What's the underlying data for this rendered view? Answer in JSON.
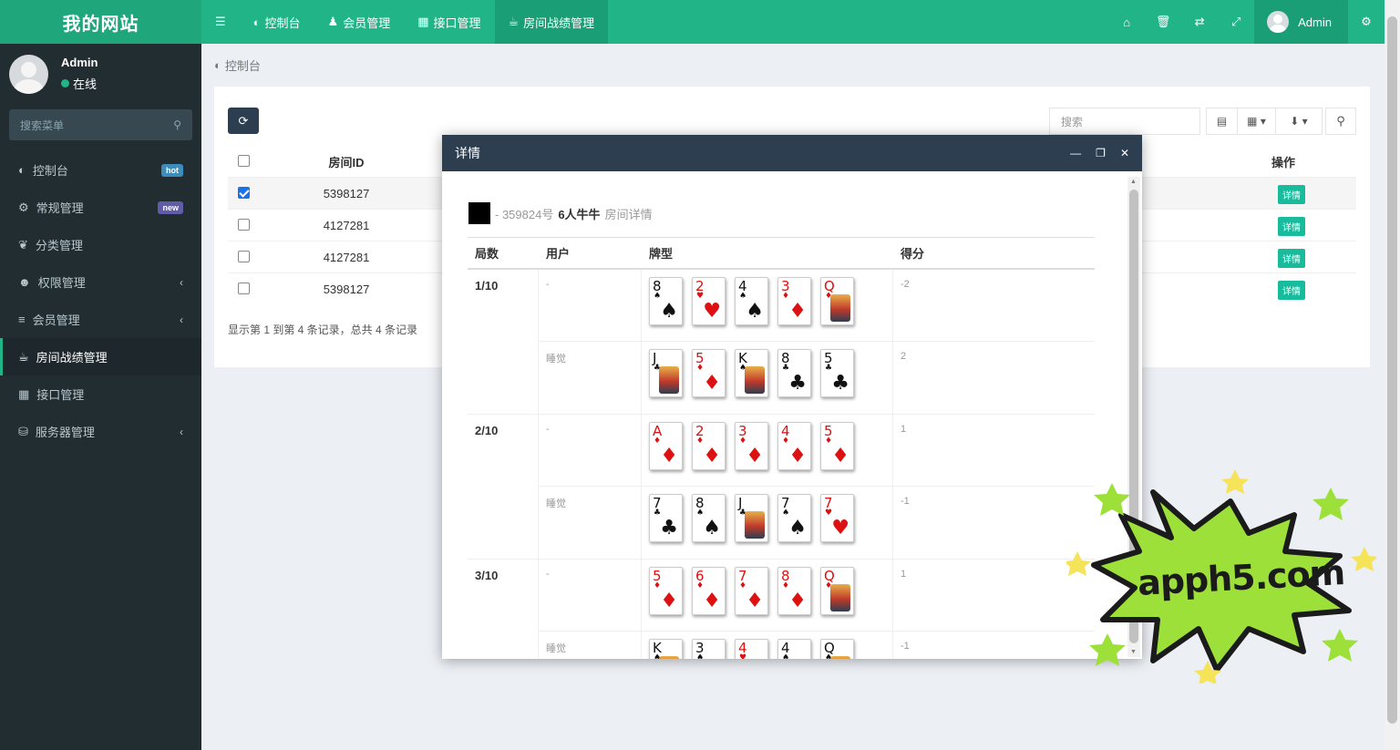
{
  "app": {
    "logo": "我的网站"
  },
  "topnav": {
    "items": [
      {
        "icon": "dashboard-icon",
        "label": "控制台"
      },
      {
        "icon": "user-icon",
        "label": "会员管理"
      },
      {
        "icon": "calendar-icon",
        "label": "接口管理"
      },
      {
        "icon": "coffee-icon",
        "label": "房间战绩管理"
      }
    ],
    "active_index": 3,
    "right_icons": [
      "home-icon",
      "trash-icon",
      "language-icon",
      "fullscreen-icon"
    ],
    "user": "Admin",
    "settings_icon": "cogs-icon"
  },
  "sidebar": {
    "user": {
      "name": "Admin",
      "status": "在线",
      "status_color": "#20b487"
    },
    "search": {
      "placeholder": "搜索菜单"
    },
    "items": [
      {
        "icon": "dashboard-icon",
        "label": "控制台",
        "badge": "hot",
        "badge_color": "#3c8dbc"
      },
      {
        "icon": "cogs-icon",
        "label": "常规管理",
        "badge": "new",
        "badge_color": "#605ca8"
      },
      {
        "icon": "leaf-icon",
        "label": "分类管理"
      },
      {
        "icon": "group-icon",
        "label": "权限管理",
        "chevron": "‹"
      },
      {
        "icon": "list-icon",
        "label": "会员管理",
        "chevron": "‹"
      },
      {
        "icon": "coffee-icon",
        "label": "房间战绩管理",
        "active": true
      },
      {
        "icon": "calendar-icon",
        "label": "接口管理"
      },
      {
        "icon": "database-icon",
        "label": "服务器管理",
        "chevron": "‹"
      }
    ]
  },
  "breadcrumb": {
    "label": "控制台"
  },
  "toolbar": {
    "search_placeholder": "搜索"
  },
  "table": {
    "headers": {
      "id": "房间ID",
      "op": "操作"
    },
    "rows": [
      {
        "id": "5398127",
        "checked": true,
        "action": "详情"
      },
      {
        "id": "4127281",
        "checked": false,
        "action": "详情"
      },
      {
        "id": "4127281",
        "checked": false,
        "action": "详情"
      },
      {
        "id": "5398127",
        "checked": false,
        "action": "详情"
      }
    ],
    "pagination": "显示第 1 到第 4 条记录，总共 4 条记录"
  },
  "modal": {
    "title": "详情",
    "controls": [
      "minimize-icon",
      "maximize-icon",
      "close-icon"
    ],
    "room_number": "- 359824号",
    "room_game": "6人牛牛",
    "room_suffix": "房间详情",
    "headers": {
      "round": "局数",
      "user": "用户",
      "cards": "牌型",
      "score": "得分"
    },
    "rounds": [
      {
        "round": "1/10",
        "rows": [
          {
            "user": "-",
            "score": "-2",
            "cards": [
              {
                "rank": "8",
                "suit": "♠"
              },
              {
                "rank": "2",
                "suit": "♥"
              },
              {
                "rank": "4",
                "suit": "♠"
              },
              {
                "rank": "3",
                "suit": "♦"
              },
              {
                "rank": "Q",
                "suit": "♦",
                "face": true
              }
            ]
          },
          {
            "user": "睡觉",
            "score": "2",
            "cards": [
              {
                "rank": "J",
                "suit": "♣",
                "face": true
              },
              {
                "rank": "5",
                "suit": "♦"
              },
              {
                "rank": "K",
                "suit": "♠",
                "face": true
              },
              {
                "rank": "8",
                "suit": "♣"
              },
              {
                "rank": "5",
                "suit": "♣"
              }
            ]
          }
        ]
      },
      {
        "round": "2/10",
        "rows": [
          {
            "user": "-",
            "score": "1",
            "cards": [
              {
                "rank": "A",
                "suit": "♦"
              },
              {
                "rank": "2",
                "suit": "♦"
              },
              {
                "rank": "3",
                "suit": "♦"
              },
              {
                "rank": "4",
                "suit": "♦"
              },
              {
                "rank": "5",
                "suit": "♦"
              }
            ]
          },
          {
            "user": "睡觉",
            "score": "-1",
            "cards": [
              {
                "rank": "7",
                "suit": "♣"
              },
              {
                "rank": "8",
                "suit": "♠"
              },
              {
                "rank": "J",
                "suit": "♣",
                "face": true
              },
              {
                "rank": "7",
                "suit": "♠"
              },
              {
                "rank": "7",
                "suit": "♥"
              }
            ]
          }
        ]
      },
      {
        "round": "3/10",
        "rows": [
          {
            "user": "-",
            "score": "1",
            "cards": [
              {
                "rank": "5",
                "suit": "♦"
              },
              {
                "rank": "6",
                "suit": "♦"
              },
              {
                "rank": "7",
                "suit": "♦"
              },
              {
                "rank": "8",
                "suit": "♦"
              },
              {
                "rank": "Q",
                "suit": "♦",
                "face": true
              }
            ]
          },
          {
            "user": "睡觉",
            "score": "-1",
            "cards": [
              {
                "rank": "K",
                "suit": "♠",
                "face": true
              },
              {
                "rank": "3",
                "suit": "♠"
              },
              {
                "rank": "4",
                "suit": "♥"
              },
              {
                "rank": "4",
                "suit": "♠"
              },
              {
                "rank": "Q",
                "suit": "♠",
                "face": true
              }
            ]
          }
        ]
      }
    ]
  },
  "watermark": {
    "text": "apph5.com",
    "fill": "#9ee03a"
  }
}
